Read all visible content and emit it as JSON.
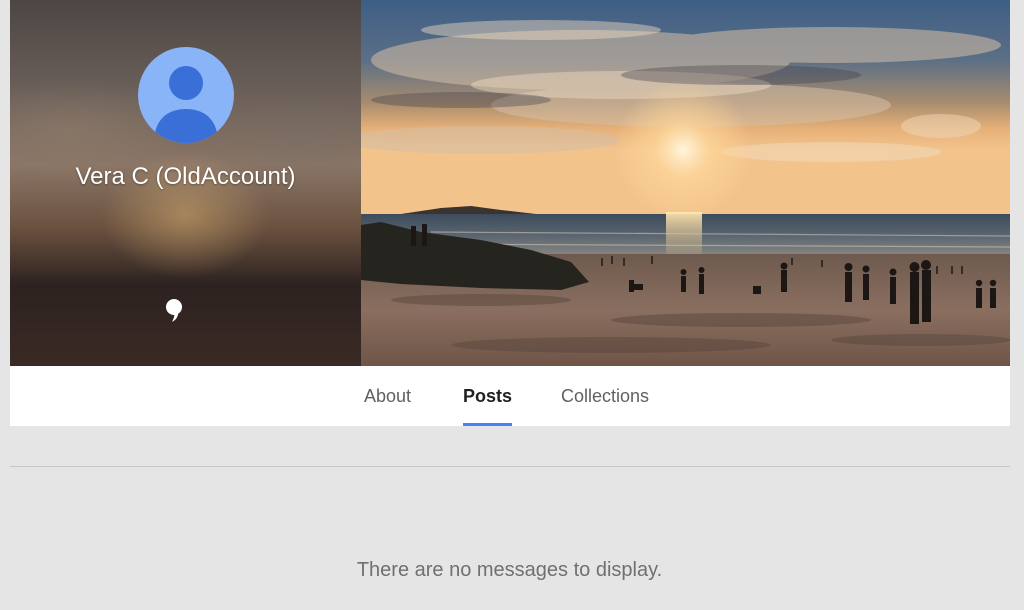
{
  "profile": {
    "name": "Vera C (OldAccount)",
    "avatar_icon": "person-icon",
    "avatar_color": "#8ab4f8",
    "avatar_figure_color": "#3b6fd8",
    "tagline_icon": "quote-icon"
  },
  "cover": {
    "icon": "sunset-beach-photo"
  },
  "tabs": [
    {
      "label": "About",
      "active": false
    },
    {
      "label": "Posts",
      "active": true
    },
    {
      "label": "Collections",
      "active": false
    }
  ],
  "colors": {
    "accent": "#4285f4",
    "page_background": "#e5e5e5"
  },
  "posts": {
    "empty_message": "There are no messages to display."
  }
}
